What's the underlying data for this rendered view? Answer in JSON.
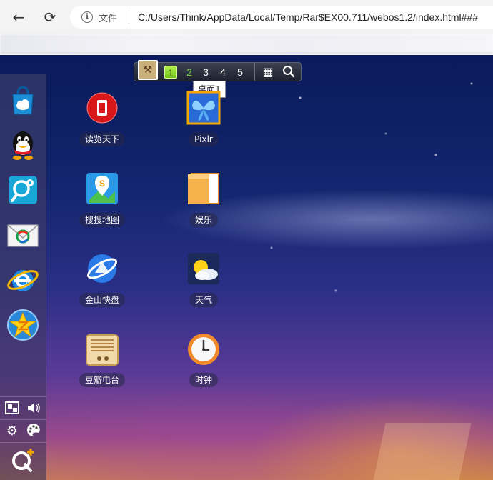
{
  "browser": {
    "file_label": "文件",
    "url": "C:/Users/Think/AppData/Local/Temp/Rar$EX00.711/webos1.2/index.html###"
  },
  "switcher": {
    "desktops": [
      "1",
      "2",
      "3",
      "4",
      "5"
    ],
    "active": "1",
    "tooltip": "桌面1"
  },
  "dock": {
    "apps": [
      {
        "name": "app-store-icon"
      },
      {
        "name": "qq-icon"
      },
      {
        "name": "search-map-icon"
      },
      {
        "name": "mail-icon"
      },
      {
        "name": "ie-browser-icon"
      },
      {
        "name": "qzone-star-icon"
      }
    ]
  },
  "desktop_icons": [
    {
      "label": "读览天下"
    },
    {
      "label": "Pixlr"
    },
    {
      "label": "搜搜地图"
    },
    {
      "label": "娱乐"
    },
    {
      "label": "金山快盘"
    },
    {
      "label": "天气"
    },
    {
      "label": "豆瓣电台"
    },
    {
      "label": "时钟"
    }
  ],
  "colors": {
    "active_desktop": "#8fdc2a",
    "wallpaper_top": "#0a1a5a",
    "wallpaper_bottom": "#c9824f"
  }
}
